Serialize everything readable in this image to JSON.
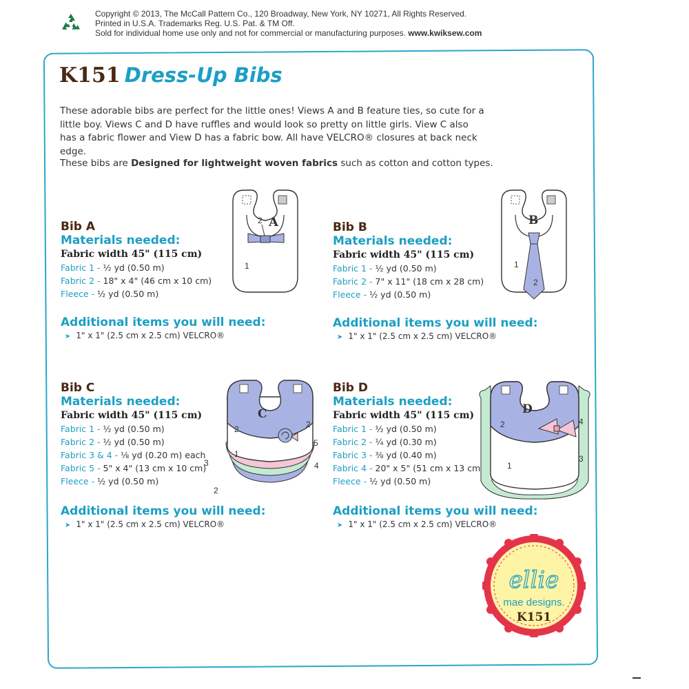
{
  "copyright": {
    "line1": "Copyright © 2013, The McCall Pattern Co., 120 Broadway, New York, NY 10271, All Rights Reserved.",
    "line2": "Printed in U.S.A. Trademarks Reg. U.S. Pat. & TM Off.",
    "line3": "Sold for individual home use only and not for commercial or manufacturing purposes.",
    "url": "www.kwiksew.com"
  },
  "title": {
    "code": "K151",
    "name": "Dress-Up Bibs"
  },
  "intro": "These adorable bibs are perfect for the little ones! Views A and B feature ties, so cute for a little boy. Views C and D have ruffles and would look so pretty on little girls. View C also has a fabric flower and View D has a fabric bow. All have VELCRO® closures at back neck edge.",
  "intro2": {
    "pre": "These bibs are ",
    "bold": "Designed for lightweight woven fabrics",
    "post": " such as cotton and cotton types."
  },
  "bibs": [
    {
      "name": "Bib A",
      "materials_label": "Materials needed:",
      "fabric_width": "Fabric width 45\" (115 cm)",
      "materials": [
        {
          "label": "Fabric 1 - ",
          "amount": "½ yd (0.50 m)"
        },
        {
          "label": "Fabric 2 - ",
          "amount": "18\" x 4\" (46 cm x 10 cm)"
        },
        {
          "label": "Fleece - ",
          "amount": "½ yd (0.50 m)"
        }
      ],
      "additional_label": "Additional items you will need:",
      "additional": "1\" x 1\" (2.5 cm x 2.5 cm) VELCRO®",
      "view": "A",
      "callouts": [
        "2",
        "1"
      ]
    },
    {
      "name": "Bib B",
      "materials_label": "Materials needed:",
      "fabric_width": "Fabric width 45\" (115 cm)",
      "materials": [
        {
          "label": "Fabric 1 - ",
          "amount": "½ yd (0.50 m)"
        },
        {
          "label": "Fabric 2 - ",
          "amount": "7\" x 11\" (18 cm x 28 cm)"
        },
        {
          "label": "Fleece - ",
          "amount": "½ yd (0.50 m)"
        }
      ],
      "additional_label": "Additional items you will need:",
      "additional": "1\" x 1\" (2.5 cm x 2.5 cm) VELCRO®",
      "view": "B",
      "callouts": [
        "1",
        "2"
      ]
    },
    {
      "name": "Bib C",
      "materials_label": "Materials needed:",
      "fabric_width": "Fabric width 45\" (115 cm)",
      "materials": [
        {
          "label": "Fabric 1 - ",
          "amount": "½ yd (0.50 m)"
        },
        {
          "label": "Fabric 2 - ",
          "amount": "½ yd (0.50 m)"
        },
        {
          "label": "Fabric 3 & 4 - ",
          "amount": "⅛ yd (0.20 m) each"
        },
        {
          "label": "Fabric 5 - ",
          "amount": "5\" x 4\" (13 cm x 10 cm)"
        },
        {
          "label": "Fleece - ",
          "amount": "½ yd (0.50 m)"
        }
      ],
      "additional_label": "Additional items you will need:",
      "additional": "1\" x 1\" (2.5 cm x 2.5 cm) VELCRO®",
      "view": "C",
      "callouts": [
        "2",
        "2",
        "5",
        "1",
        "3",
        "4",
        "2"
      ]
    },
    {
      "name": "Bib D",
      "materials_label": "Materials needed:",
      "fabric_width": "Fabric width 45\" (115 cm)",
      "materials": [
        {
          "label": "Fabric 1 - ",
          "amount": "½ yd (0.50 m)"
        },
        {
          "label": "Fabric 2 - ",
          "amount": "¼ yd (0.30 m)"
        },
        {
          "label": "Fabric 3 - ",
          "amount": "⅜ yd (0.40 m)"
        },
        {
          "label": "Fabric 4 - ",
          "amount": "20\" x 5\" (51 cm x 13 cm)"
        },
        {
          "label": "Fleece - ",
          "amount": "½ yd (0.50 m)"
        }
      ],
      "additional_label": "Additional items you will need:",
      "additional": "1\" x 1\" (2.5 cm x 2.5 cm) VELCRO®",
      "view": "D",
      "callouts": [
        "4",
        "2",
        "3",
        "1"
      ]
    }
  ],
  "badge": {
    "script": "ellie",
    "line2": "mae designs.",
    "code": "K151"
  },
  "colors": {
    "teal": "#1c9fc4",
    "brown": "#4a2812",
    "lavender": "#a9b3e3",
    "mint": "#c5ead2",
    "pink": "#f4c6d6",
    "badge_red": "#e4344a",
    "badge_yellow": "#fdf4a6"
  },
  "icons": {
    "recycle": "recycle-icon"
  }
}
